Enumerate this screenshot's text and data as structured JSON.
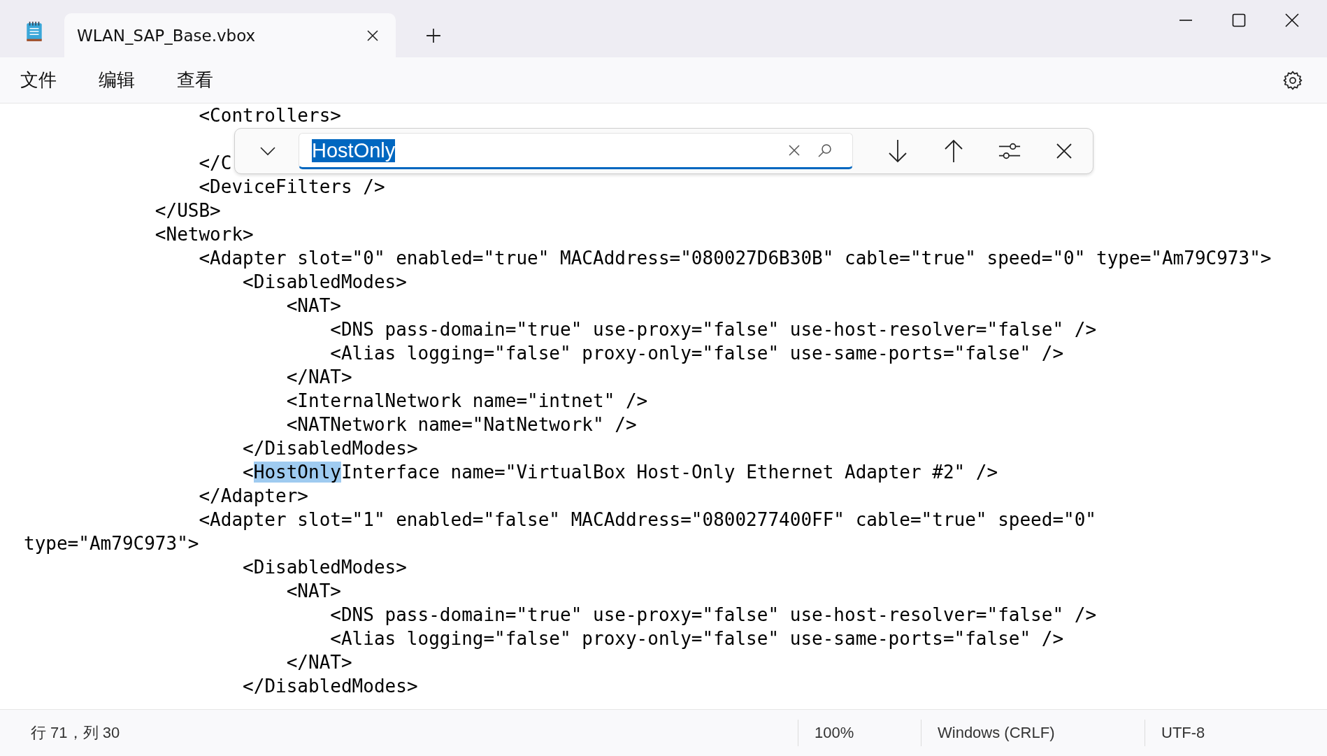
{
  "window": {
    "tab_title": "WLAN_SAP_Base.vbox"
  },
  "menu": [
    "文件",
    "编辑",
    "查看"
  ],
  "find": {
    "query": "HostOnly",
    "query_selected": true
  },
  "editor": {
    "lines": [
      {
        "kind": "code",
        "segments": [
          {
            "text": "                <Controllers>",
            "highlighted": false
          }
        ]
      },
      {
        "kind": "covered"
      },
      {
        "kind": "code",
        "segments": [
          {
            "text": "                </C",
            "highlighted": false
          }
        ]
      },
      {
        "kind": "code",
        "segments": [
          {
            "text": "                <DeviceFilters />",
            "highlighted": false
          }
        ]
      },
      {
        "kind": "code",
        "segments": [
          {
            "text": "            </USB>",
            "highlighted": false
          }
        ]
      },
      {
        "kind": "code",
        "segments": [
          {
            "text": "            <Network>",
            "highlighted": false
          }
        ]
      },
      {
        "kind": "code",
        "segments": [
          {
            "text": "                <Adapter slot=\"0\" enabled=\"true\" MACAddress=\"080027D6B30B\" cable=\"true\" speed=\"0\" type=\"Am79C973\">",
            "highlighted": false
          }
        ]
      },
      {
        "kind": "code",
        "segments": [
          {
            "text": "                    <DisabledModes>",
            "highlighted": false
          }
        ]
      },
      {
        "kind": "code",
        "segments": [
          {
            "text": "                        <NAT>",
            "highlighted": false
          }
        ]
      },
      {
        "kind": "code",
        "segments": [
          {
            "text": "                            <DNS pass-domain=\"true\" use-proxy=\"false\" use-host-resolver=\"false\" />",
            "highlighted": false
          }
        ]
      },
      {
        "kind": "code",
        "segments": [
          {
            "text": "                            <Alias logging=\"false\" proxy-only=\"false\" use-same-ports=\"false\" />",
            "highlighted": false
          }
        ]
      },
      {
        "kind": "code",
        "segments": [
          {
            "text": "                        </NAT>",
            "highlighted": false
          }
        ]
      },
      {
        "kind": "code",
        "segments": [
          {
            "text": "                        <InternalNetwork name=\"intnet\" />",
            "highlighted": false
          }
        ]
      },
      {
        "kind": "code",
        "segments": [
          {
            "text": "                        <NATNetwork name=\"NatNetwork\" />",
            "highlighted": false
          }
        ]
      },
      {
        "kind": "code",
        "segments": [
          {
            "text": "                    </DisabledModes>",
            "highlighted": false
          }
        ]
      },
      {
        "kind": "code",
        "segments": [
          {
            "text": "                    <",
            "highlighted": false
          },
          {
            "text": "HostOnly",
            "highlighted": true
          },
          {
            "text": "Interface name=\"VirtualBox Host-Only Ethernet Adapter #2\" />",
            "highlighted": false
          }
        ]
      },
      {
        "kind": "code",
        "segments": [
          {
            "text": "                </Adapter>",
            "highlighted": false
          }
        ]
      },
      {
        "kind": "code",
        "segments": [
          {
            "text": "                <Adapter slot=\"1\" enabled=\"false\" MACAddress=\"0800277400FF\" cable=\"true\" speed=\"0\" type=\"Am79C973\">",
            "highlighted": false
          }
        ]
      },
      {
        "kind": "code",
        "segments": [
          {
            "text": "                    <DisabledModes>",
            "highlighted": false
          }
        ]
      },
      {
        "kind": "code",
        "segments": [
          {
            "text": "                        <NAT>",
            "highlighted": false
          }
        ]
      },
      {
        "kind": "code",
        "segments": [
          {
            "text": "                            <DNS pass-domain=\"true\" use-proxy=\"false\" use-host-resolver=\"false\" />",
            "highlighted": false
          }
        ]
      },
      {
        "kind": "code",
        "segments": [
          {
            "text": "                            <Alias logging=\"false\" proxy-only=\"false\" use-same-ports=\"false\" />",
            "highlighted": false
          }
        ]
      },
      {
        "kind": "code",
        "segments": [
          {
            "text": "                        </NAT>",
            "highlighted": false
          }
        ]
      },
      {
        "kind": "code",
        "segments": [
          {
            "text": "                    </DisabledModes>",
            "highlighted": false
          }
        ]
      }
    ]
  },
  "status_bar": {
    "position": "行 71，列 30",
    "zoom": "100%",
    "line_ending": "Windows (CRLF)",
    "encoding": "UTF-8"
  }
}
